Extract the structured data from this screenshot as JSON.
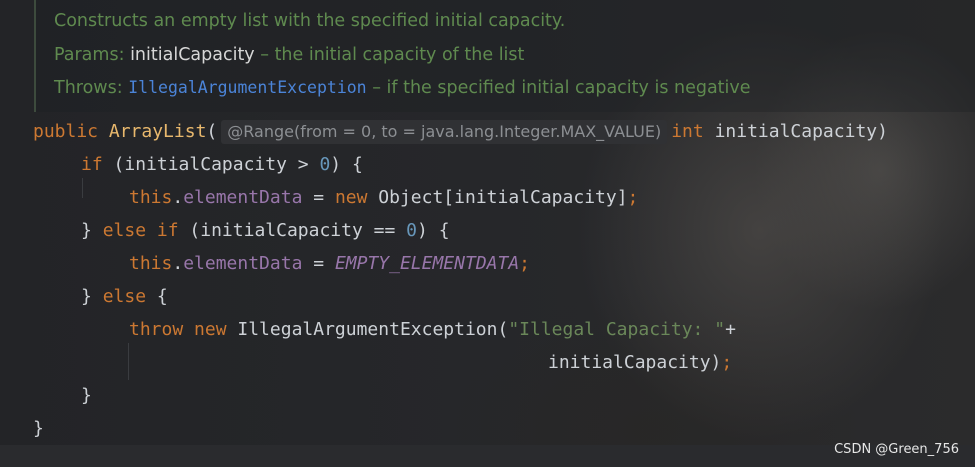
{
  "doc": {
    "description": "Constructs an empty list with the specified initial capacity.",
    "params_label": "Params:",
    "param_name": "initialCapacity",
    "param_desc": "– the initial capacity of the list",
    "throws_label": "Throws:",
    "throws_type": "IllegalArgumentException",
    "throws_desc": "– if the specified initial capacity is negative"
  },
  "code": {
    "public": "public",
    "ctor": "ArrayList",
    "open_paren": "(",
    "annotation": "@Range(from = 0, to = java.lang.Integer.MAX_VALUE)",
    "int": "int",
    "param": "initialCapacity)",
    "if": "if",
    "cond1": "(initialCapacity > ",
    "zero": "0",
    "cond1_end": ") {",
    "this": "this",
    "dot": ".",
    "elementData": "elementData",
    "assign": " = ",
    "new": "new",
    "new_obj": " Object[initialCapacity]",
    "semicolon": ";",
    "close_else": "} ",
    "else": "else",
    "space": " ",
    "cond2": "(initialCapacity == ",
    "cond2_end": ") {",
    "empty_const": "EMPTY_ELEMENTDATA",
    "else_open": " {",
    "throw": "throw",
    "exception_ctor": " IllegalArgumentException(",
    "msg": "\"Illegal Capacity: \"",
    "plus": "+",
    "cont": "initialCapacity)",
    "close_brace": "}"
  },
  "watermark": "CSDN @Green_756"
}
